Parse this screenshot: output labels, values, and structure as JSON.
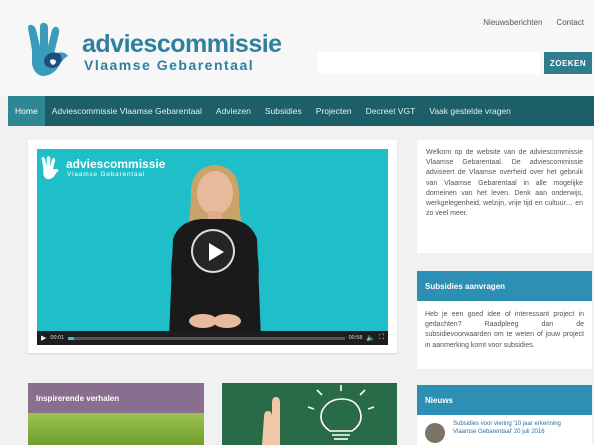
{
  "header": {
    "links": [
      "Nieuwsberichten",
      "Contact"
    ],
    "logo_line1": "adviescommissie",
    "logo_line2": "Vlaamse Gebarentaal",
    "search_placeholder": "",
    "search_button": "ZOEKEN"
  },
  "nav": {
    "items": [
      {
        "label": "Home",
        "active": true
      },
      {
        "label": "Adviescommissie Vlaamse Gebarentaal",
        "active": false
      },
      {
        "label": "Adviezen",
        "active": false
      },
      {
        "label": "Subsidies",
        "active": false
      },
      {
        "label": "Projecten",
        "active": false
      },
      {
        "label": "Decreet VGT",
        "active": false
      },
      {
        "label": "Vaak gestelde vragen",
        "active": false
      }
    ]
  },
  "video": {
    "logo_line1": "adviescommissie",
    "logo_line2": "Vlaamse Gebarentaal",
    "time_current": "00:01",
    "time_total": "00:58",
    "progress": 0.02
  },
  "welcome": {
    "text": "Welkom op de website van de adviescommissie Vlaamse Gebarentaal. De adviescommissie adviseert de Vlaamse overheid over het gebruik van Vlaamse Gebarentaal in alle mogelijke domeinen van het leven. Denk aan onderwijs, werkgelegenheid, welzijn, vrije tijd en cultuur… en zo veel meer."
  },
  "subsidies": {
    "title": "Subsidies aanvragen",
    "text": "Heb je een goed idee of interessant project in gedachten? Raadpleeg dan de subsidievoorwaarden om te weten of jouw project in aanmerking komt voor subsidies."
  },
  "news": {
    "title": "Nieuws",
    "items": [
      "Subsidies voor viering '10 jaar erkenning Vlaamse Gebarentaal' 20 juli 2016"
    ]
  },
  "inspiring": {
    "title": "Inspirerende verhalen"
  },
  "colors": {
    "nav_bg": "#1d5f68",
    "nav_active": "#2d8795",
    "brand": "#2f7fa0",
    "card_head": "#2d8fb3",
    "video_bg": "#1fbfc9",
    "inspiring_head": "#8a6e90"
  }
}
